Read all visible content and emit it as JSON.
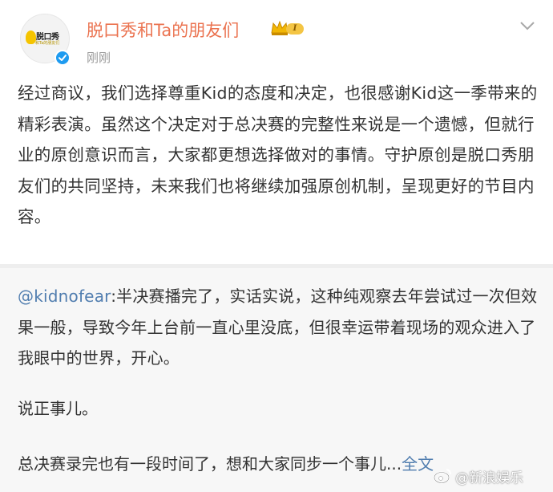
{
  "header": {
    "avatar": {
      "logo_text": "脱口秀",
      "logo_subtext": "和Ta的朋友们"
    },
    "username": "脱口秀和Ta的朋友们",
    "vip_level": "I",
    "timestamp": "刚刚",
    "more_icon": "chevron-down-icon"
  },
  "post": {
    "text": "经过商议，我们选择尊重Kid的态度和决定，也很感谢Kid这一季带来的精彩表演。虽然这个决定对于总决赛的完整性来说是一个遗憾，但就行业的原创意识而言，大家都更想选择做对的事情。守护原创是脱口秀朋友们的共同坚持，未来我们也将继续加强原创机制，呈现更好的节目内容。"
  },
  "repost": {
    "mention": "@kidnofear",
    "paragraph1": ":半决赛播完了，实话实说，这种纯观察去年尝试过一次但效果一般，导致今年上台前一直心里没底，但很幸运带着现场的观众进入了我眼中的世界，开心。",
    "paragraph2": "说正事儿。",
    "paragraph3": "总决赛录完也有一段时间了，想和大家同步一个事儿...",
    "full_text_link": "全文"
  },
  "watermark": {
    "text": "@新浪娱乐",
    "icon": "weibo-icon"
  },
  "colors": {
    "username": "#eb7350",
    "link": "#507daf",
    "verified": "#1e9bf0",
    "repost_bg": "#f7f7f7",
    "timestamp": "#999999"
  }
}
